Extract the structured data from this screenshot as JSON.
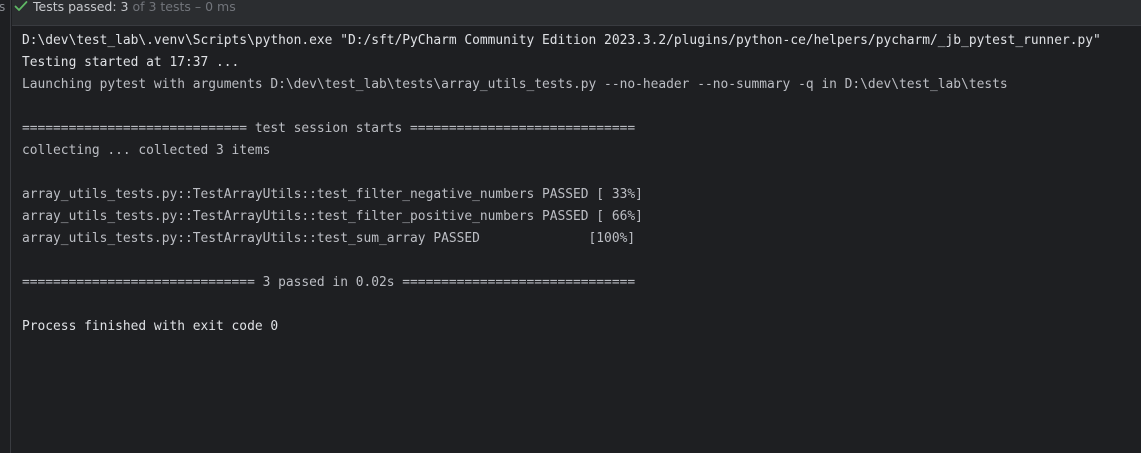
{
  "gutter": {
    "letter": "s"
  },
  "status": {
    "icon": "check-icon",
    "icon_color": "#5fb865",
    "passed_label": "Tests passed: 3",
    "total_suffix": " of 3 tests – 0 ms"
  },
  "console": {
    "lines": [
      {
        "text": "D:\\dev\\test_lab\\.venv\\Scripts\\python.exe \"D:/sft/PyCharm Community Edition 2023.3.2/plugins/python-ce/helpers/pycharm/_jb_pytest_runner.py\"",
        "style": "bright"
      },
      {
        "text": "Testing started at 17:37 ...",
        "style": "bright"
      },
      {
        "text": "Launching pytest with arguments D:\\dev\\test_lab\\tests\\array_utils_tests.py --no-header --no-summary -q in D:\\dev\\test_lab\\tests",
        "style": "normal"
      },
      {
        "text": "",
        "style": "normal"
      },
      {
        "text": "============================= test session starts =============================",
        "style": "normal"
      },
      {
        "text": "collecting ... collected 3 items",
        "style": "normal"
      },
      {
        "text": "",
        "style": "normal"
      },
      {
        "text": "array_utils_tests.py::TestArrayUtils::test_filter_negative_numbers PASSED [ 33%]",
        "style": "normal"
      },
      {
        "text": "array_utils_tests.py::TestArrayUtils::test_filter_positive_numbers PASSED [ 66%]",
        "style": "normal"
      },
      {
        "text": "array_utils_tests.py::TestArrayUtils::test_sum_array PASSED              [100%]",
        "style": "normal"
      },
      {
        "text": "",
        "style": "normal"
      },
      {
        "text": "============================== 3 passed in 0.02s ==============================",
        "style": "normal"
      },
      {
        "text": "",
        "style": "normal"
      },
      {
        "text": "Process finished with exit code 0",
        "style": "bright"
      }
    ]
  }
}
